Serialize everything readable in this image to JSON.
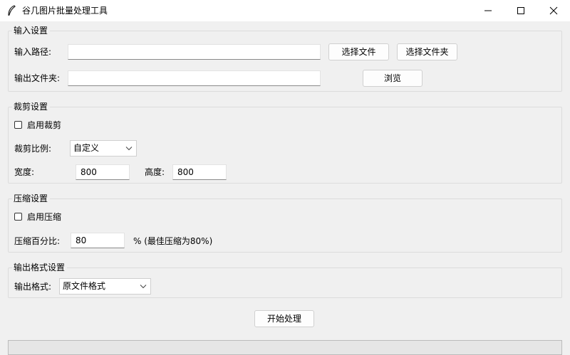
{
  "window": {
    "title": "谷几图片批量处理工具"
  },
  "input_settings": {
    "legend": "输入设置",
    "input_path_label": "输入路径:",
    "input_path_value": "",
    "select_file_label": "选择文件",
    "select_folder_label": "选择文件夹",
    "output_folder_label": "输出文件夹:",
    "output_folder_value": "",
    "browse_label": "浏览"
  },
  "crop_settings": {
    "legend": "裁剪设置",
    "enable_label": "启用裁剪",
    "enable_checked": false,
    "ratio_label": "裁剪比例:",
    "ratio_value": "自定义",
    "width_label": "宽度:",
    "width_value": "800",
    "height_label": "高度:",
    "height_value": "800"
  },
  "compress_settings": {
    "legend": "压缩设置",
    "enable_label": "启用压缩",
    "enable_checked": false,
    "percent_label": "压缩百分比:",
    "percent_value": "80",
    "percent_hint": "% (最佳压缩为80%)"
  },
  "output_format_settings": {
    "legend": "输出格式设置",
    "format_label": "输出格式:",
    "format_value": "原文件格式"
  },
  "actions": {
    "start_label": "开始处理"
  },
  "progress": {
    "value": 0
  }
}
